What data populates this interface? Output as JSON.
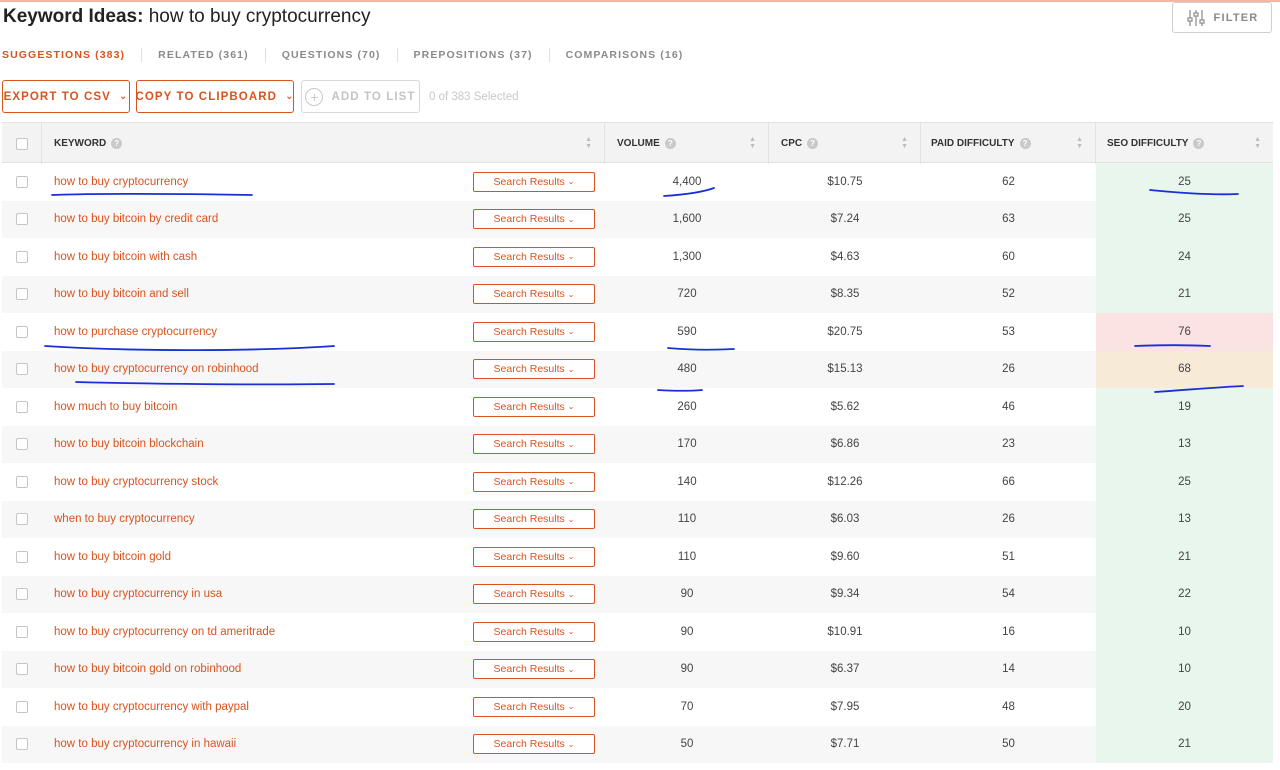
{
  "header": {
    "title_label": "Keyword Ideas:",
    "title_query": "how to buy cryptocurrency",
    "filter_label": "FILTER"
  },
  "tabs": [
    {
      "label": "SUGGESTIONS (383)",
      "active": true
    },
    {
      "label": "RELATED (361)",
      "active": false
    },
    {
      "label": "QUESTIONS (70)",
      "active": false
    },
    {
      "label": "PREPOSITIONS (37)",
      "active": false
    },
    {
      "label": "COMPARISONS (16)",
      "active": false
    }
  ],
  "toolbar": {
    "export_label": "EXPORT TO CSV",
    "copy_label": "COPY TO CLIPBOARD",
    "add_label": "ADD TO LIST",
    "selected_text": "0 of 383 Selected"
  },
  "table": {
    "columns": {
      "keyword": "KEYWORD",
      "volume": "VOLUME",
      "cpc": "CPC",
      "paid": "PAID DIFFICULTY",
      "seo": "SEO DIFFICULTY"
    },
    "serp_label": "Search Results",
    "seo_colors": {
      "easy": "#e8f6ee",
      "hard": "#fbe3e3",
      "medium": "#f7ebd8"
    },
    "rows": [
      {
        "keyword": "how to buy cryptocurrency",
        "volume": "4,400",
        "cpc": "$10.75",
        "paid": "62",
        "seo": "25",
        "seo_level": "easy"
      },
      {
        "keyword": "how to buy bitcoin by credit card",
        "volume": "1,600",
        "cpc": "$7.24",
        "paid": "63",
        "seo": "25",
        "seo_level": "easy"
      },
      {
        "keyword": "how to buy bitcoin with cash",
        "volume": "1,300",
        "cpc": "$4.63",
        "paid": "60",
        "seo": "24",
        "seo_level": "easy"
      },
      {
        "keyword": "how to buy bitcoin and sell",
        "volume": "720",
        "cpc": "$8.35",
        "paid": "52",
        "seo": "21",
        "seo_level": "easy"
      },
      {
        "keyword": "how to purchase cryptocurrency",
        "volume": "590",
        "cpc": "$20.75",
        "paid": "53",
        "seo": "76",
        "seo_level": "hard"
      },
      {
        "keyword": "how to buy cryptocurrency on robinhood",
        "volume": "480",
        "cpc": "$15.13",
        "paid": "26",
        "seo": "68",
        "seo_level": "medium"
      },
      {
        "keyword": "how much to buy bitcoin",
        "volume": "260",
        "cpc": "$5.62",
        "paid": "46",
        "seo": "19",
        "seo_level": "easy"
      },
      {
        "keyword": "how to buy bitcoin blockchain",
        "volume": "170",
        "cpc": "$6.86",
        "paid": "23",
        "seo": "13",
        "seo_level": "easy"
      },
      {
        "keyword": "how to buy cryptocurrency stock",
        "volume": "140",
        "cpc": "$12.26",
        "paid": "66",
        "seo": "25",
        "seo_level": "easy"
      },
      {
        "keyword": "when to buy cryptocurrency",
        "volume": "110",
        "cpc": "$6.03",
        "paid": "26",
        "seo": "13",
        "seo_level": "easy"
      },
      {
        "keyword": "how to buy bitcoin gold",
        "volume": "110",
        "cpc": "$9.60",
        "paid": "51",
        "seo": "21",
        "seo_level": "easy"
      },
      {
        "keyword": "how to buy cryptocurrency in usa",
        "volume": "90",
        "cpc": "$9.34",
        "paid": "54",
        "seo": "22",
        "seo_level": "easy"
      },
      {
        "keyword": "how to buy cryptocurrency on td ameritrade",
        "volume": "90",
        "cpc": "$10.91",
        "paid": "16",
        "seo": "10",
        "seo_level": "easy"
      },
      {
        "keyword": "how to buy bitcoin gold on robinhood",
        "volume": "90",
        "cpc": "$6.37",
        "paid": "14",
        "seo": "10",
        "seo_level": "easy"
      },
      {
        "keyword": "how to buy cryptocurrency with paypal",
        "volume": "70",
        "cpc": "$7.95",
        "paid": "48",
        "seo": "20",
        "seo_level": "easy"
      },
      {
        "keyword": "how to buy cryptocurrency in hawaii",
        "volume": "50",
        "cpc": "$7.71",
        "paid": "50",
        "seo": "21",
        "seo_level": "easy"
      }
    ]
  },
  "icons": {
    "filter": "filter-sliders-icon",
    "add": "plus-circle-icon",
    "help": "help-circle-icon",
    "sort": "sort-arrows-icon",
    "chevron": "chevron-down-icon"
  },
  "accent_color": "#d9531e",
  "annotation_color": "#1a2fd6"
}
